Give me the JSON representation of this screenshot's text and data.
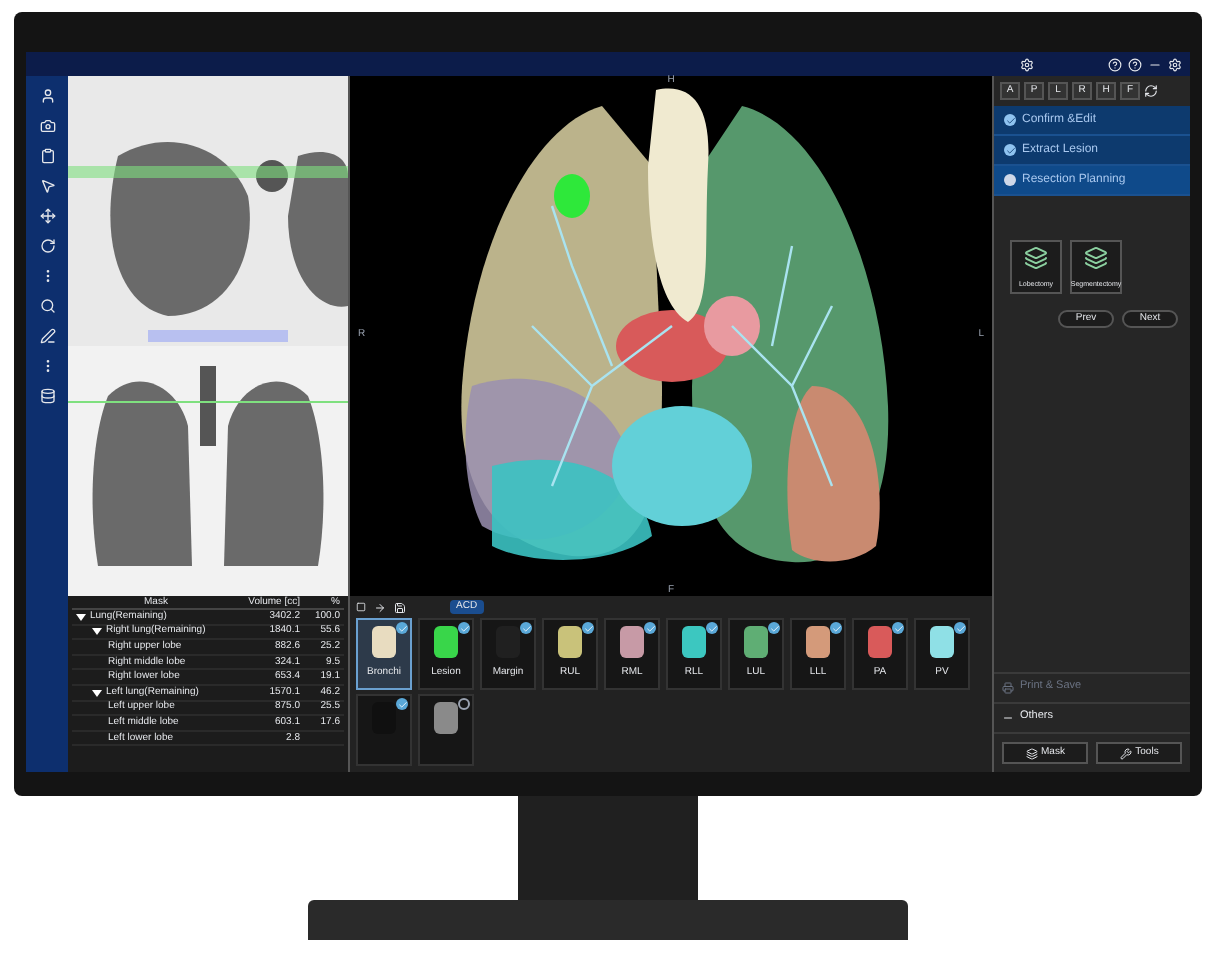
{
  "view_tabs": [
    "A",
    "P",
    "L",
    "R",
    "H",
    "F"
  ],
  "steps": [
    {
      "label": "Confirm &Edit",
      "done": true,
      "selected": false
    },
    {
      "label": "Extract Lesion",
      "done": true,
      "selected": false
    },
    {
      "label": "Resection Planning",
      "done": false,
      "selected": true
    }
  ],
  "plans": [
    {
      "label": "Lobectomy"
    },
    {
      "label": "Segmentectomy"
    }
  ],
  "nav_buttons": [
    "Prev",
    "Next"
  ],
  "sections": [
    {
      "label": "Print & Save",
      "expanded": false
    },
    {
      "label": "Others",
      "expanded": true
    }
  ],
  "bottom_buttons": [
    "Mask",
    "Tools"
  ],
  "orientation": {
    "top": "H",
    "left": "R",
    "right": "L",
    "bottom": "F"
  },
  "strip_badge": "ACD",
  "table": {
    "columns": [
      "Mask",
      "Volume [cc]",
      "%"
    ],
    "rows": [
      {
        "name": "Lung(Remaining)",
        "volume": "3402.2",
        "percent": "100.0",
        "expanded": true,
        "children": [
          {
            "name": "Right lung(Remaining)",
            "volume": "1840.1",
            "percent": "55.6",
            "expanded": true,
            "children": [
              {
                "name": "Right upper lobe",
                "volume": "882.6",
                "percent": "25.2"
              },
              {
                "name": "Right middle lobe",
                "volume": "324.1",
                "percent": "9.5"
              },
              {
                "name": "Right lower lobe",
                "volume": "653.4",
                "percent": "19.1"
              }
            ]
          },
          {
            "name": "Left lung(Remaining)",
            "volume": "1570.1",
            "percent": "46.2",
            "expanded": true,
            "children": [
              {
                "name": "Left upper lobe",
                "volume": "875.0",
                "percent": "25.5"
              },
              {
                "name": "Left middle lobe",
                "volume": "603.1",
                "percent": "17.6"
              },
              {
                "name": "Left lower lobe",
                "volume": "2.8"
              }
            ]
          }
        ]
      }
    ]
  },
  "thumbnails": [
    {
      "label": "Bronchi",
      "color": "#e8dcc0",
      "selected": true,
      "checked": true
    },
    {
      "label": "Lesion",
      "color": "#39d64a",
      "selected": false,
      "checked": true
    },
    {
      "label": "Margin",
      "color": "#202020",
      "selected": false,
      "checked": true
    },
    {
      "label": "RUL",
      "color": "#c9c27a",
      "selected": false,
      "checked": true
    },
    {
      "label": "RML",
      "color": "#c79aa6",
      "selected": false,
      "checked": true
    },
    {
      "label": "RLL",
      "color": "#3cc7c0",
      "selected": false,
      "checked": true
    },
    {
      "label": "LUL",
      "color": "#5fae74",
      "selected": false,
      "checked": true
    },
    {
      "label": "LLL",
      "color": "#d49a7a",
      "selected": false,
      "checked": true
    },
    {
      "label": "PA",
      "color": "#d95a5a",
      "selected": false,
      "checked": true
    },
    {
      "label": "PV",
      "color": "#8fe0e6",
      "selected": false,
      "checked": true
    },
    {
      "color": "#101010",
      "selected": false,
      "checked": true
    },
    {
      "color": "#8a8a8a",
      "selected": false,
      "checked": false
    }
  ]
}
